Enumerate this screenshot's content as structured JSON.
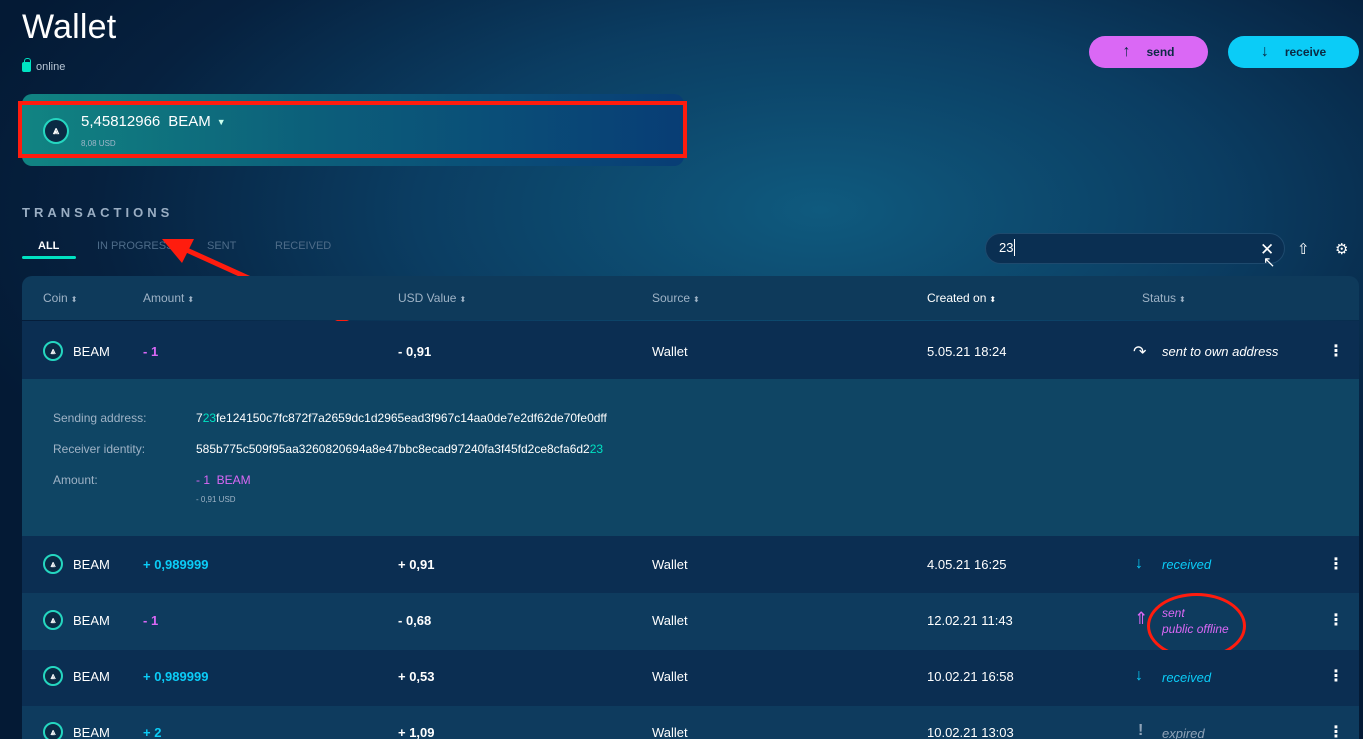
{
  "app": {
    "title": "Wallet",
    "connection_status": "online"
  },
  "actions": {
    "send_label": "send",
    "receive_label": "receive"
  },
  "balance": {
    "amount": "5,45812966",
    "currency": "BEAM",
    "usd": "8,08 USD"
  },
  "transactions": {
    "section_title": "TRANSACTIONS",
    "tabs": [
      "ALL",
      "IN PROGRESS",
      "SENT",
      "RECEIVED"
    ],
    "active_tab": "ALL",
    "search_value": "23",
    "columns": [
      "Coin",
      "Amount",
      "USD Value",
      "Source",
      "Created on",
      "Status"
    ],
    "rows": [
      {
        "coin": "BEAM",
        "amount": "- 1",
        "usd_value": "- 0,91",
        "source": "Wallet",
        "created_on": "5.05.21 18:24",
        "status": "sent to own address"
      },
      {
        "coin": "BEAM",
        "amount": "+ 0,989999",
        "usd_value": "+ 0,91",
        "source": "Wallet",
        "created_on": "4.05.21 16:25",
        "status": "received"
      },
      {
        "coin": "BEAM",
        "amount": "- 1",
        "usd_value": "- 0,68",
        "source": "Wallet",
        "created_on": "12.02.21 11:43",
        "status_line1": "sent",
        "status_line2": "public offline"
      },
      {
        "coin": "BEAM",
        "amount": "+ 0,989999",
        "usd_value": "+ 0,53",
        "source": "Wallet",
        "created_on": "10.02.21 16:58",
        "status": "received"
      },
      {
        "coin": "BEAM",
        "amount": "+ 2",
        "usd_value": "+ 1,09",
        "source": "Wallet",
        "created_on": "10.02.21 13:03",
        "status": "expired"
      }
    ],
    "details": {
      "sending_address_label": "Sending address:",
      "sending_address_pre": "7",
      "sending_address_match": "23",
      "sending_address_post": "fe124150c7fc872f7a2659dc1d2965ead3f967c14aa0de7e2df62de70fe0dff",
      "receiver_identity_label": "Receiver identity:",
      "receiver_identity_pre": "585b775c509f95aa3260820694a8e47bbc8ecad97240fa3f45fd2ce8cfa6d2",
      "receiver_identity_match": "23",
      "amount_label": "Amount:",
      "amount_value": "- 1  BEAM",
      "amount_usd": "- 0,91 USD"
    }
  },
  "colors": {
    "accent_teal": "#00e2c2",
    "send_pink": "#da68f5",
    "receive_cyan": "#0bccf7",
    "annotation_red": "#ff1c0e"
  }
}
